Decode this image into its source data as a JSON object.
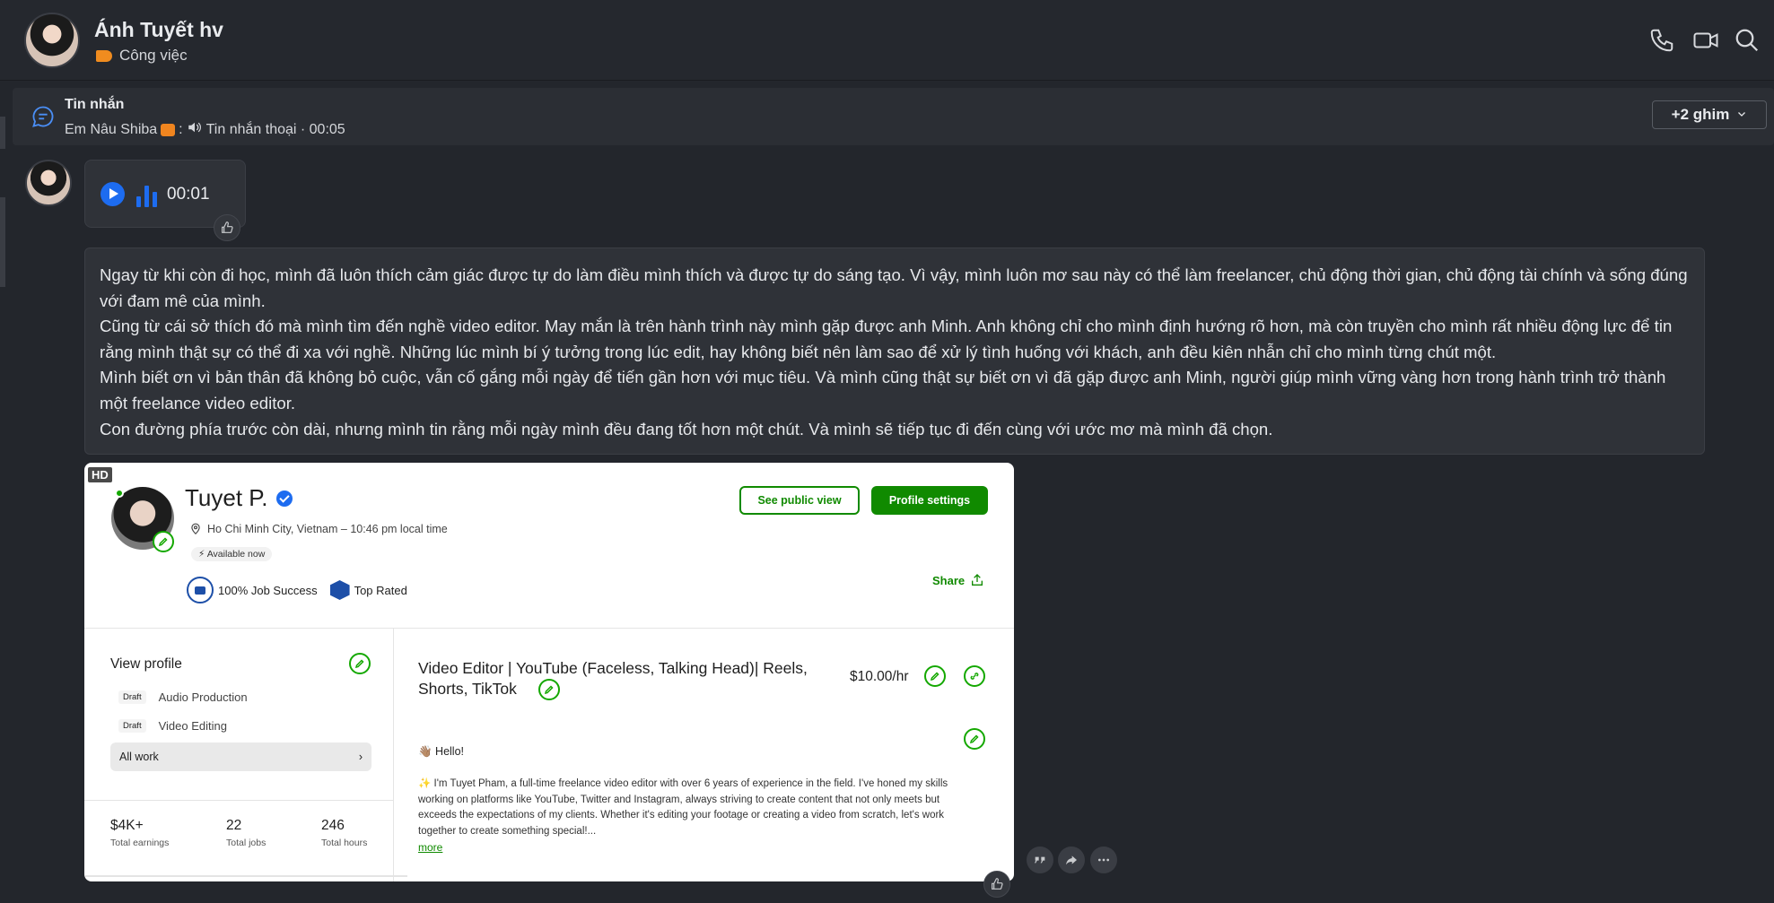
{
  "header": {
    "name": "Ánh Tuyết hv",
    "tag": "Công việc",
    "tag_color": "#f08c1f"
  },
  "pinned": {
    "title": "Tin nhắn",
    "sender": "Em Nâu Shiba",
    "separator": ":",
    "content": "Tin nhắn thoại · 00:05",
    "more_pins": "+2 ghim"
  },
  "voice_message": {
    "duration": "00:01",
    "accent": "#1d6cf0"
  },
  "text_message": {
    "paragraphs": [
      "Ngay từ khi còn đi học, mình đã luôn thích cảm giác được tự do làm điều mình thích và được tự do sáng tạo. Vì vậy, mình luôn mơ sau này có thể làm freelancer, chủ động thời gian, chủ động tài chính và sống đúng với đam mê của mình.",
      "Cũng từ cái sở thích đó mà mình tìm đến nghề video editor. May mắn là trên hành trình này mình gặp được anh Minh. Anh không chỉ cho mình định hướng rõ hơn, mà còn truyền cho mình rất nhiều động lực để tin rằng mình thật sự có thể đi xa với nghề. Những lúc mình bí ý tưởng trong lúc edit, hay không biết nên làm sao để xử lý tình huống với khách, anh đều kiên nhẫn chỉ cho mình từng chút một.",
      "Mình biết ơn vì bản thân đã không bỏ cuộc, vẫn cố gắng mỗi ngày để tiến gần hơn với mục tiêu. Và mình cũng thật sự biết ơn vì đã gặp được anh Minh, người giúp mình vững vàng hơn trong hành trình trở thành một freelance video editor.",
      "Con đường phía trước còn dài, nhưng mình tin rằng mỗi ngày mình đều đang tốt hơn một chút. Và mình sẽ tiếp tục đi đến cùng với ước mơ mà mình đã chọn."
    ]
  },
  "image_message": {
    "hd_badge": "HD",
    "profile": {
      "name": "Tuyet P.",
      "location": "Ho Chi Minh City, Vietnam – 10:46 pm local time",
      "availability": "Available now",
      "job_success": "100% Job Success",
      "top_rated": "Top Rated",
      "see_public_view": "See public view",
      "profile_settings": "Profile settings",
      "share": "Share",
      "brand_color": "#108a00",
      "view_profile": "View profile",
      "drafts": [
        {
          "badge": "Draft",
          "label": "Audio Production"
        },
        {
          "badge": "Draft",
          "label": "Video Editing"
        }
      ],
      "all_work": "All work",
      "stats": [
        {
          "value": "$4K+",
          "label": "Total earnings"
        },
        {
          "value": "22",
          "label": "Total jobs"
        },
        {
          "value": "246",
          "label": "Total hours"
        }
      ],
      "job_title": "Video Editor | YouTube (Faceless, Talking Head)| Reels, Shorts, TikTok",
      "rate": "$10.00/hr",
      "hello": "👋🏽 Hello!",
      "bio": "✨ I'm Tuyet Pham, a full-time freelance video editor with over 6 years of experience in the field. I've honed my skills working on platforms like YouTube, Twitter and Instagram, always striving to create content that not only meets but exceeds the expectations of my clients. Whether it's editing your footage or creating a video from scratch, let's work together to create something special!...",
      "more": "more"
    }
  },
  "actions": [
    "quote-icon",
    "forward-icon",
    "more-icon"
  ]
}
